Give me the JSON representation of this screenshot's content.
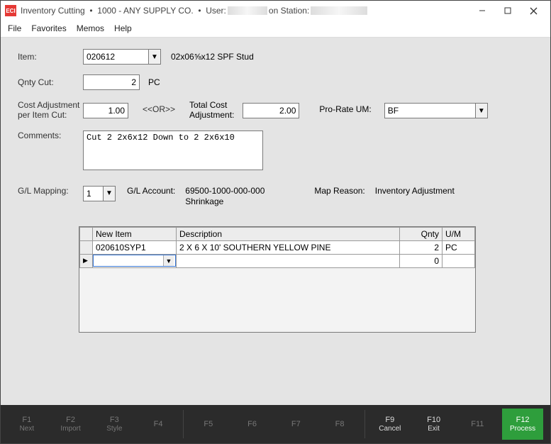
{
  "title": {
    "app": "Inventory Cutting",
    "sep1": "  •  ",
    "acct": "1000 - ANY SUPPLY CO.",
    "sep2": "  •  ",
    "user_label": "User:",
    "on_station": "on Station:"
  },
  "menu": {
    "file": "File",
    "favorites": "Favorites",
    "memos": "Memos",
    "help": "Help"
  },
  "labels": {
    "item": "Item:",
    "qnty_cut": "Qnty Cut:",
    "cost_adj1": "Cost Adjustment",
    "cost_adj2": "per Item Cut:",
    "or": "<<OR>>",
    "total_cost1": "Total Cost",
    "total_cost2": "Adjustment:",
    "prorate": "Pro-Rate UM:",
    "comments": "Comments:",
    "gl_mapping": "G/L Mapping:",
    "gl_account": "G/L Account:",
    "map_reason": "Map Reason:"
  },
  "values": {
    "item": "020612",
    "item_desc": "02x06⅝x12 SPF Stud",
    "qnty_cut": "2",
    "qnty_unit": "PC",
    "cost_adj": "1.00",
    "total_cost": "2.00",
    "prorate_um": "BF",
    "comments": "Cut 2 2x6x12 Down to 2 2x6x10",
    "gl_mapping": "1",
    "gl_account_1": "69500-1000-000-000",
    "gl_account_2": "Shrinkage",
    "map_reason": "Inventory Adjustment"
  },
  "grid": {
    "headers": {
      "new_item": "New Item",
      "description": "Description",
      "qnty": "Qnty",
      "um": "U/M"
    },
    "rows": [
      {
        "new_item": "020610SYP1",
        "description": "2 X 6 X 10' SOUTHERN YELLOW PINE",
        "qnty": "2",
        "um": "PC"
      },
      {
        "new_item": "",
        "description": "",
        "qnty": "0",
        "um": ""
      }
    ],
    "active_row_marker": "▶"
  },
  "fn": {
    "f1": {
      "k": "F1",
      "t": "Next"
    },
    "f2": {
      "k": "F2",
      "t": "Import"
    },
    "f3": {
      "k": "F3",
      "t": "Style"
    },
    "f4": {
      "k": "F4",
      "t": ""
    },
    "f5": {
      "k": "F5",
      "t": ""
    },
    "f6": {
      "k": "F6",
      "t": ""
    },
    "f7": {
      "k": "F7",
      "t": ""
    },
    "f8": {
      "k": "F8",
      "t": ""
    },
    "f9": {
      "k": "F9",
      "t": "Cancel"
    },
    "f10": {
      "k": "F10",
      "t": "Exit"
    },
    "f11": {
      "k": "F11",
      "t": ""
    },
    "f12": {
      "k": "F12",
      "t": "Process"
    }
  }
}
